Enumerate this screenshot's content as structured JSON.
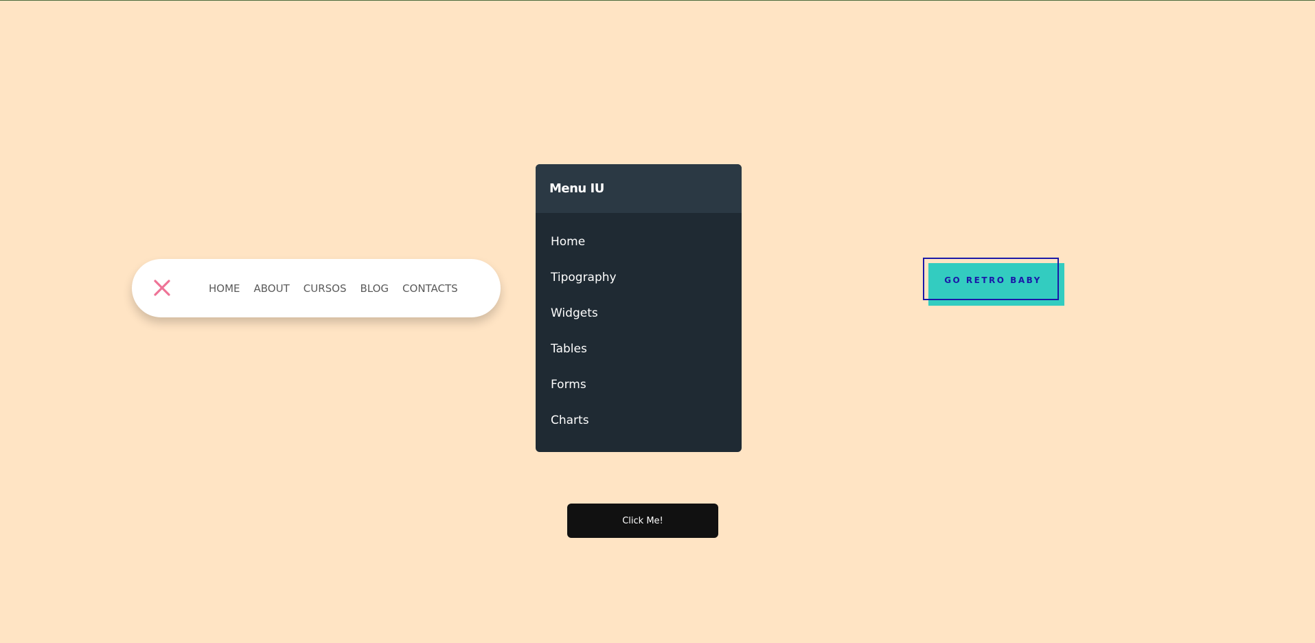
{
  "colors": {
    "page_background": "#FFE4C4",
    "close_icon": "#EE7396",
    "menu_background": "#1F2A33",
    "menu_header_background": "#2B3944",
    "retro_accent": "#33CCC0",
    "retro_border": "#1A18A8",
    "click_button_background": "#111111"
  },
  "pill_nav": {
    "close_icon": "close-icon",
    "links": [
      "HOME",
      "ABOUT",
      "CURSOS",
      "BLOG",
      "CONTACTS"
    ]
  },
  "menu": {
    "title": "Menu IU",
    "items": [
      "Home",
      "Tipography",
      "Widgets",
      "Tables",
      "Forms",
      "Charts"
    ]
  },
  "retro_button": {
    "label": "GO RETRO BABY"
  },
  "click_button": {
    "label": "Click Me!"
  }
}
